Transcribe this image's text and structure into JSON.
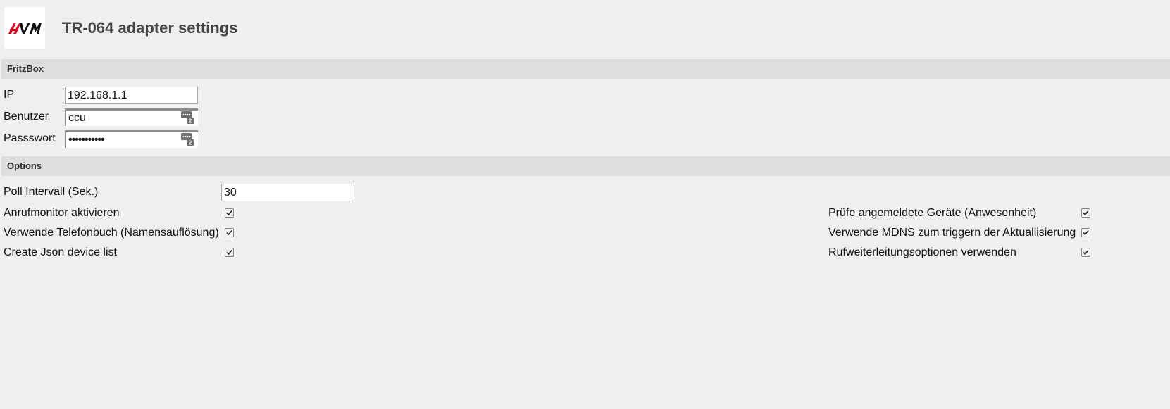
{
  "header": {
    "logo_text": "AVM",
    "title": "TR-064 adapter settings"
  },
  "sections": {
    "fritzbox": "FritzBox",
    "options": "Options"
  },
  "fritzbox": {
    "ip_label": "IP",
    "ip_value": "192.168.1.1",
    "user_label": "Benutzer",
    "user_value": "ccu",
    "password_label": "Passswort",
    "password_value": "•••••••••••"
  },
  "options": {
    "poll_label": "Poll Intervall (Sek.)",
    "poll_value": "30",
    "left": [
      {
        "label": "Anrufmonitor aktivieren",
        "checked": true
      },
      {
        "label": "Verwende Telefonbuch (Namensauflösung)",
        "checked": true
      },
      {
        "label": "Create Json device list",
        "checked": true
      }
    ],
    "right": [
      {
        "label": "Prüfe angemeldete Geräte (Anwesenheit)",
        "checked": true
      },
      {
        "label": "Verwende MDNS zum triggern der Aktuallisierung",
        "checked": true
      },
      {
        "label": "Rufweiterleitungsoptionen verwenden",
        "checked": true
      }
    ]
  },
  "colors": {
    "background": "#efefef",
    "section_bar": "#dedede",
    "logo_red": "#e2001a",
    "logo_black": "#000000"
  }
}
